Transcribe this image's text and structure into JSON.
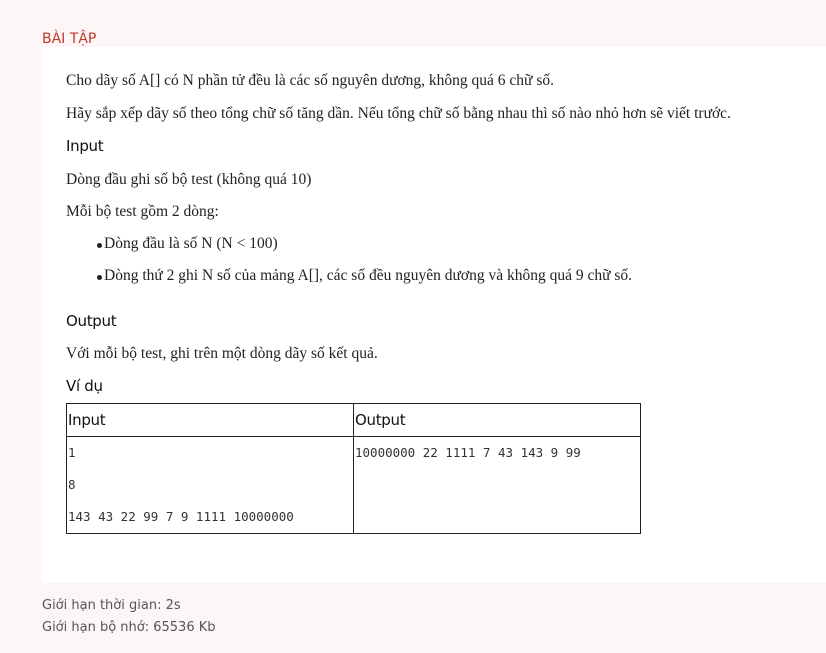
{
  "section_title": "BÀI TẬP",
  "problem": {
    "description": [
      "Cho dãy số A[] có N phần tử đều là các số nguyên dương, không quá 6 chữ số.",
      "Hãy sắp xếp dãy số theo tổng chữ số tăng dần. Nếu tổng chữ số bằng nhau thì số nào nhỏ hơn sẽ viết trước."
    ],
    "input_heading": "Input",
    "input_lines": [
      "Dòng đầu ghi số bộ test (không quá 10)",
      "Mỗi bộ test gồm 2 dòng:"
    ],
    "input_bullets": [
      "Dòng đầu là số N (N < 100)",
      "Dòng thứ 2 ghi N số của mảng A[], các số đều nguyên dương và không quá 9 chữ số."
    ],
    "output_heading": "Output",
    "output_line": "Với mỗi bộ test, ghi trên một dòng dãy số kết quả.",
    "example_heading": "Ví dụ",
    "example_table": {
      "headers": [
        "Input",
        "Output"
      ],
      "input_lines": [
        "1",
        "8",
        "143 43 22 99 7 9 1111 10000000"
      ],
      "output_lines": [
        "10000000 22 1111 7 43 143 9 99"
      ]
    }
  },
  "limits": {
    "time": "Giới hạn thời gian: 2s",
    "memory": "Giới hạn bộ nhớ: 65536 Kb"
  }
}
